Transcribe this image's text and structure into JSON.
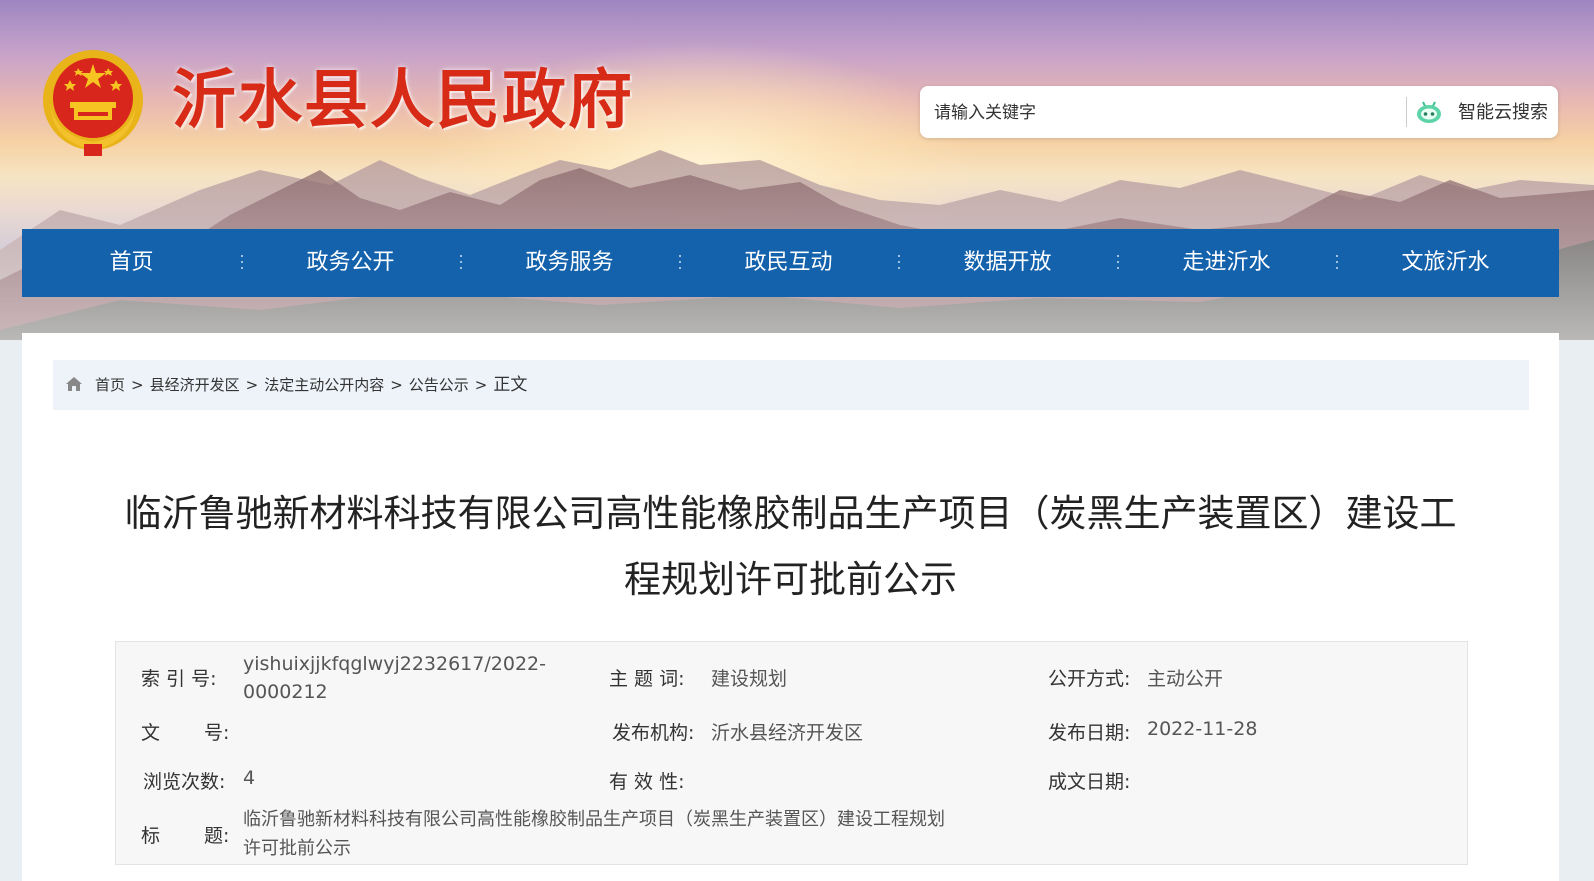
{
  "header": {
    "site_title": "沂水县人民政府",
    "search": {
      "placeholder": "请输入关键字",
      "button_label": "智能云搜索"
    }
  },
  "nav": {
    "items": [
      {
        "label": "首页"
      },
      {
        "label": "政务公开"
      },
      {
        "label": "政务服务"
      },
      {
        "label": "政民互动"
      },
      {
        "label": "数据开放"
      },
      {
        "label": "走进沂水"
      },
      {
        "label": "文旅沂水"
      }
    ]
  },
  "breadcrumb": {
    "items": [
      "首页",
      "县经济开发区",
      "法定主动公开内容",
      "公告公示"
    ],
    "separator": ">",
    "current": "正文"
  },
  "article": {
    "title_line1": "临沂鲁驰新材料科技有限公司高性能橡胶制品生产项目（炭黑生产装置区）建设工",
    "title_line2": "程规划许可批前公示"
  },
  "meta": {
    "index_label": "索 引 号:",
    "index_value_line1": "yishuixjjkfqglwyj2232617/2022-",
    "index_value_line2": "0000212",
    "topic_label": "主 题 词:",
    "topic_value": "建设规划",
    "disclosure_label": "公开方式:",
    "disclosure_value": "主动公开",
    "doc_no_label_a": "文",
    "doc_no_label_b": "号:",
    "publisher_label": "发布机构:",
    "publisher_value": "沂水县经济开发区",
    "pub_date_label": "发布日期:",
    "pub_date_value": "2022-11-28",
    "views_label": "浏览次数:",
    "views_value": "4",
    "validity_label": "有 效 性:",
    "written_date_label": "成文日期:",
    "title_label_a": "标",
    "title_label_b": "题:",
    "title_value_line1": "临沂鲁驰新材料科技有限公司高性能橡胶制品生产项目（炭黑生产装置区）建设工程规划",
    "title_value_line2": "许可批前公示"
  },
  "colors": {
    "nav_bg": "#1461ac",
    "title_red": "#d72b18",
    "breadcrumb_bg": "#eef3f9"
  }
}
